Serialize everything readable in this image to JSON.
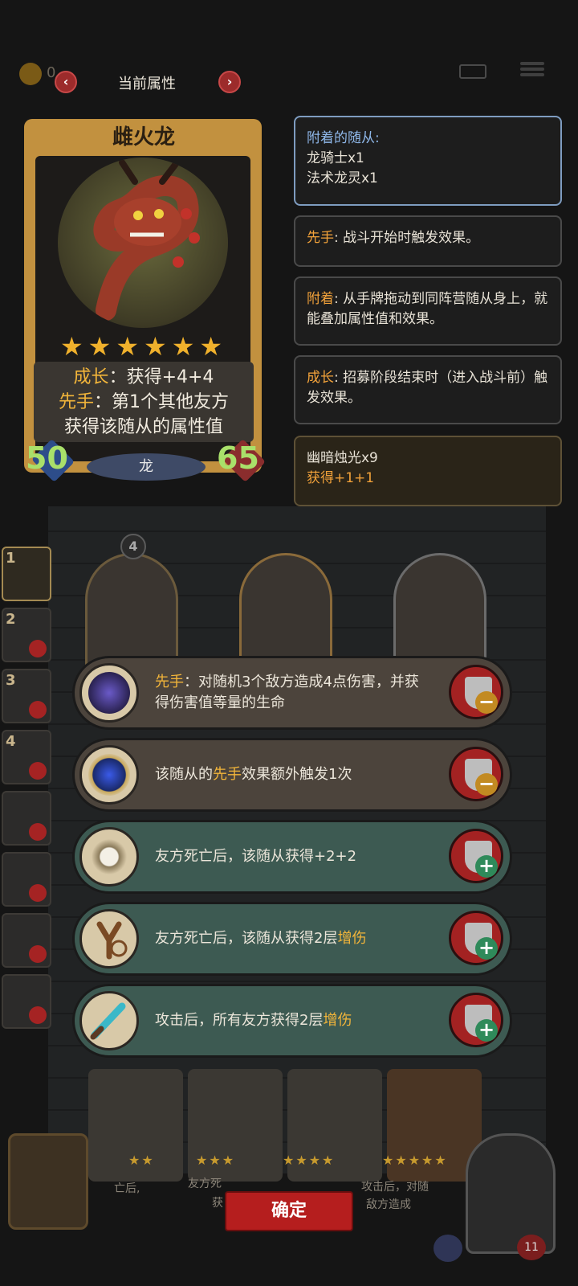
{
  "topbar": {
    "coin_value": "0",
    "title": "当前属性",
    "prev_arrow": "‹",
    "next_arrow": "›"
  },
  "card": {
    "name": "雌火龙",
    "stars": "★★★★★★",
    "star_count": 6,
    "desc_line1_kw": "成长",
    "desc_line1_rest": "：获得+4+4",
    "desc_line2_kw": "先手",
    "desc_line2_rest": "：第1个其他友方",
    "desc_line3": "获得该随从的属性值",
    "attack": "50",
    "health": "65",
    "tribe": "龙"
  },
  "info_panels": {
    "attached_title": "附着的随从:",
    "attached_1": "龙骑士x1",
    "attached_2": "法术龙灵x1",
    "p2_kw": "先手",
    "p2_text": ": 战斗开始时触发效果。",
    "p3_kw": "附着",
    "p3_text": ": 从手牌拖动到同阵营随从身上，就能叠加属性值和效果。",
    "p4_kw": "成长",
    "p4_text": ": 招募阶段结束时（进入战斗前）触发效果。",
    "p5_line1": "幽暗烛光x9",
    "p5_line2": "获得+1+1"
  },
  "background": {
    "unit_level": "4",
    "sidebar_nums": [
      "1",
      "2",
      "3",
      "4"
    ],
    "bottom_text_left": "亡后,",
    "bottom_text_mid": "友方死",
    "bottom_text_mid2": "获",
    "bottom_text_right": "攻击后，对随",
    "bottom_text_right2": "敌方造成",
    "hearts": "11"
  },
  "effects": [
    {
      "kw": "先手",
      "text_pre": "",
      "text": "：对随机3个敌方造成4点伤害，并获得伤害值等量的生命",
      "kw2": "",
      "button": "remove"
    },
    {
      "kw": "",
      "text_pre": "该随从的",
      "kw_mid": "先手",
      "text": "效果额外触发1次",
      "button": "remove"
    },
    {
      "text": "友方死亡后，该随从获得+2+2",
      "button": "add"
    },
    {
      "text": "友方死亡后，该随从获得2层",
      "kw_end": "增伤",
      "button": "add"
    },
    {
      "text": "攻击后，所有友方获得2层",
      "kw_end": "增伤",
      "button": "add"
    }
  ],
  "confirm_label": "确定",
  "colors": {
    "keyword_gold": "#f2b53a",
    "keyword_blue": "#8fb8ea",
    "keyword_orange": "#f2a23a",
    "remove_row": "#4c443c",
    "add_row": "#3d5a52",
    "confirm": "#b51e1e"
  }
}
